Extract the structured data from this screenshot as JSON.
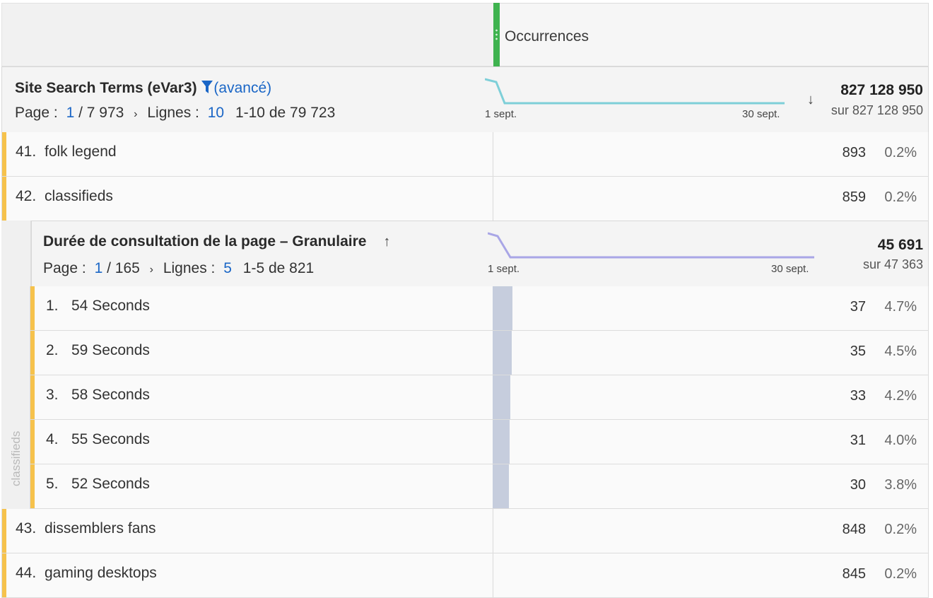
{
  "header": {
    "column_title": "Occurrences"
  },
  "dimension": {
    "title": "Site Search Terms (eVar3)",
    "filter_label": "(avancé)",
    "page_label": "Page :",
    "page_current": "1",
    "page_total": "/ 7 973",
    "rows_label": "Lignes :",
    "rows_count": "10",
    "range": "1-10 de 79 723",
    "spark_start": "1 sept.",
    "spark_end": "30 sept.",
    "total": "827 128 950",
    "total_sub": "sur 827 128 950",
    "sort_icon": "arrow-down-icon",
    "spark_color": "#7ecfd8"
  },
  "rows_top": [
    {
      "rank": "41.",
      "label": "folk legend",
      "value": "893",
      "pct": "0.2%"
    },
    {
      "rank": "42.",
      "label": "classifieds",
      "value": "859",
      "pct": "0.2%"
    }
  ],
  "breakdown": {
    "side_label": "classifieds",
    "title": "Durée de consultation de la page – Granulaire",
    "page_label": "Page :",
    "page_current": "1",
    "page_total": "/ 165",
    "rows_label": "Lignes :",
    "rows_count": "5",
    "range": "1-5 de 821",
    "spark_start": "1 sept.",
    "spark_end": "30 sept.",
    "total": "45 691",
    "total_sub": "sur 47 363",
    "sort_icon": "arrow-up-icon",
    "spark_color": "#a9a6e6",
    "rows": [
      {
        "rank": "1.",
        "label": "54 Seconds",
        "value": "37",
        "pct": "4.7%",
        "share": 0.047
      },
      {
        "rank": "2.",
        "label": "59 Seconds",
        "value": "35",
        "pct": "4.5%",
        "share": 0.045
      },
      {
        "rank": "3.",
        "label": "58 Seconds",
        "value": "33",
        "pct": "4.2%",
        "share": 0.042
      },
      {
        "rank": "4.",
        "label": "55 Seconds",
        "value": "31",
        "pct": "4.0%",
        "share": 0.04
      },
      {
        "rank": "5.",
        "label": "52 Seconds",
        "value": "30",
        "pct": "3.8%",
        "share": 0.038
      }
    ]
  },
  "rows_bottom": [
    {
      "rank": "43.",
      "label": "dissemblers fans",
      "value": "848",
      "pct": "0.2%"
    },
    {
      "rank": "44.",
      "label": "gaming desktops",
      "value": "845",
      "pct": "0.2%"
    }
  ],
  "colors": {
    "accent_row": "#f6c24c",
    "header_grip": "#3fb34f",
    "link": "#1a66c6",
    "bar": "#c6cddd"
  }
}
